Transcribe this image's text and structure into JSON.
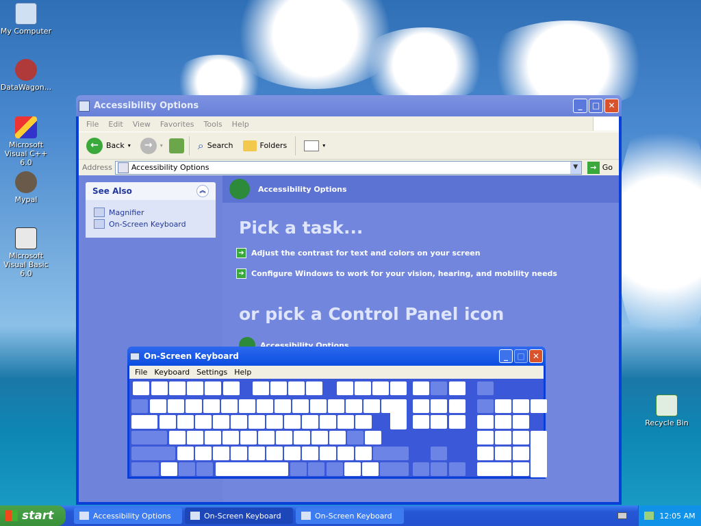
{
  "desktop": {
    "icons": [
      {
        "label": "My Computer"
      },
      {
        "label": "DataWagon..."
      },
      {
        "label": "Microsoft Visual C++ 6.0"
      },
      {
        "label": "Mypal"
      },
      {
        "label": "Microsoft Visual Basic 6.0"
      },
      {
        "label": "Recycle Bin"
      }
    ]
  },
  "explorer": {
    "title": "Accessibility Options",
    "menu": [
      "File",
      "Edit",
      "View",
      "Favorites",
      "Tools",
      "Help"
    ],
    "toolbar": {
      "back": "Back",
      "search": "Search",
      "folders": "Folders"
    },
    "address": {
      "label": "Address",
      "value": "Accessibility Options",
      "go": "Go"
    },
    "see_also": {
      "title": "See Also",
      "items": [
        "Magnifier",
        "On-Screen Keyboard"
      ]
    },
    "main": {
      "header": "Accessibility Options",
      "pick_task": "Pick a task...",
      "tasks": [
        "Adjust the contrast for text and colors on your screen",
        "Configure Windows to work for your vision, hearing, and mobility needs"
      ],
      "pick_icon": "or pick a Control Panel icon",
      "icon_item": "Accessibility Options"
    }
  },
  "osk": {
    "title": "On-Screen Keyboard",
    "menu": [
      "File",
      "Keyboard",
      "Settings",
      "Help"
    ]
  },
  "taskbar": {
    "start": "start",
    "items": [
      "Accessibility Options",
      "On-Screen Keyboard",
      "On-Screen Keyboard"
    ],
    "clock": "12:05 AM"
  }
}
